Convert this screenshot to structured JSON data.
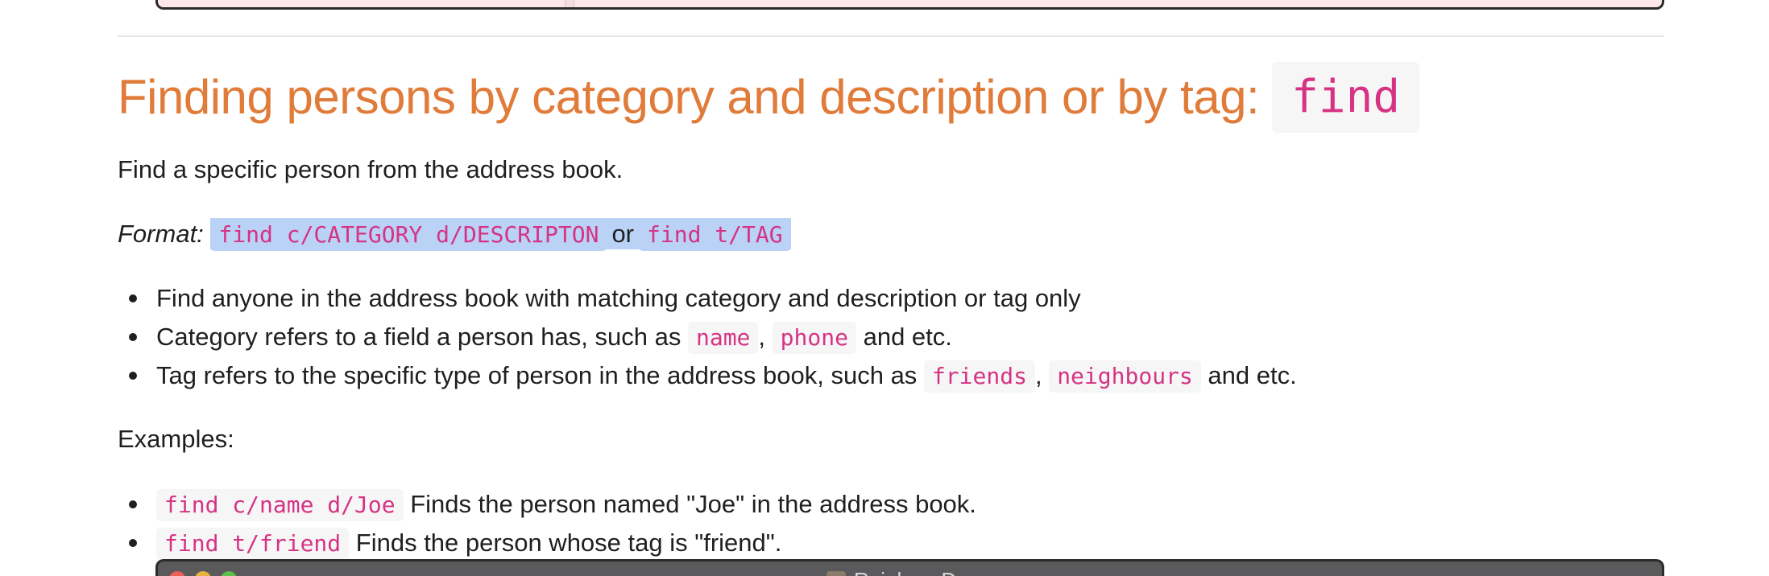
{
  "heading": {
    "text": "Finding persons by category and description or by tag:",
    "code": "find"
  },
  "intro": "Find a specific person from the address book.",
  "format": {
    "label": "Format:",
    "command1": "find c/CATEGORY d/DESCRIPTON",
    "joiner": "or",
    "command2": "find t/TAG"
  },
  "notes": [
    {
      "text": "Find anyone in the address book with matching category and description or tag only"
    },
    {
      "prefix": "Category refers to a field a person has, such as",
      "code1": "name",
      "sep": ",",
      "code2": "phone",
      "suffix": "and etc."
    },
    {
      "prefix": "Tag refers to the specific type of person in the address book, such as",
      "code1": "friends",
      "sep": ",",
      "code2": "neighbours",
      "suffix": "and etc."
    }
  ],
  "examples_label": "Examples:",
  "examples": [
    {
      "code": "find c/name d/Joe",
      "text": "Finds the person named \"Joe\" in the address book."
    },
    {
      "code": "find t/friend",
      "text": "Finds the person whose tag is \"friend\"."
    }
  ],
  "bottom_window": {
    "title": "Rainbow Dragon",
    "icon": "app-icon"
  },
  "colors": {
    "heading": "#e07b39",
    "code_text": "#d63384",
    "code_bg": "#f6f6f6",
    "selection": "#b9d2f6"
  }
}
